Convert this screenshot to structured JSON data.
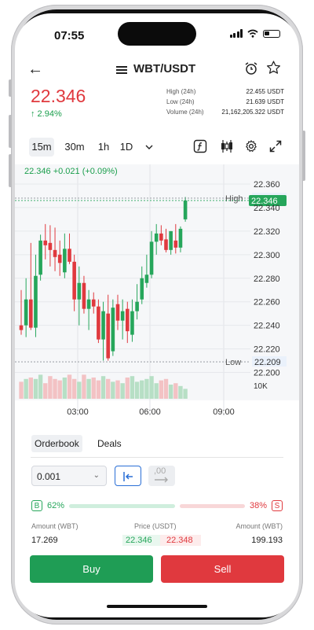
{
  "status": {
    "time": "07:55"
  },
  "header": {
    "pair": "WBT/USDT"
  },
  "ticker": {
    "price": "22.346",
    "change": "↑ 2.94%",
    "stats": [
      {
        "label": "High (24h)",
        "value": "22.455 USDT"
      },
      {
        "label": "Low (24h)",
        "value": "21.639 USDT"
      },
      {
        "label": "Volume (24h)",
        "value": "21,162,205.322 USDT"
      }
    ]
  },
  "toolbar": {
    "timeframes": [
      "15m",
      "30m",
      "1h",
      "1D"
    ],
    "active_timeframe": "15m",
    "icons": [
      "chevron-down-icon",
      "formula-icon",
      "candles-icon",
      "gear-icon",
      "expand-icon"
    ]
  },
  "chart_data": {
    "type": "candlestick",
    "title": "",
    "header_label": "22.346 +0.021 (+0.09%)",
    "xlabel": "",
    "ylabel": "",
    "x_ticks": [
      "03:00",
      "06:00",
      "09:00"
    ],
    "y_ticks": [
      "22.360",
      "22.340",
      "22.320",
      "22.300",
      "22.280",
      "22.260",
      "22.240",
      "22.220",
      "22.200"
    ],
    "ylim": [
      22.195,
      22.362
    ],
    "markers": [
      {
        "label": "High",
        "value": "22.348",
        "price": 22.348
      },
      {
        "label": "",
        "value": "22.346",
        "price": 22.346
      },
      {
        "label": "Low",
        "value": "22.209",
        "price": 22.209
      }
    ],
    "volume_label": "10K",
    "candles": [
      {
        "o": 22.24,
        "h": 22.27,
        "l": 22.232,
        "c": 22.236
      },
      {
        "o": 22.24,
        "h": 22.28,
        "l": 22.23,
        "c": 22.262
      },
      {
        "o": 22.262,
        "h": 22.31,
        "l": 22.236,
        "c": 22.238
      },
      {
        "o": 22.238,
        "h": 22.3,
        "l": 22.23,
        "c": 22.282
      },
      {
        "o": 22.283,
        "h": 22.317,
        "l": 22.278,
        "c": 22.312
      },
      {
        "o": 22.312,
        "h": 22.326,
        "l": 22.296,
        "c": 22.308
      },
      {
        "o": 22.31,
        "h": 22.325,
        "l": 22.29,
        "c": 22.304
      },
      {
        "o": 22.304,
        "h": 22.323,
        "l": 22.286,
        "c": 22.298
      },
      {
        "o": 22.3,
        "h": 22.312,
        "l": 22.282,
        "c": 22.293
      },
      {
        "o": 22.285,
        "h": 22.318,
        "l": 22.28,
        "c": 22.305
      },
      {
        "o": 22.305,
        "h": 22.318,
        "l": 22.292,
        "c": 22.294
      },
      {
        "o": 22.294,
        "h": 22.3,
        "l": 22.252,
        "c": 22.262
      },
      {
        "o": 22.262,
        "h": 22.29,
        "l": 22.24,
        "c": 22.276
      },
      {
        "o": 22.276,
        "h": 22.282,
        "l": 22.25,
        "c": 22.254
      },
      {
        "o": 22.254,
        "h": 22.27,
        "l": 22.236,
        "c": 22.262
      },
      {
        "o": 22.262,
        "h": 22.268,
        "l": 22.25,
        "c": 22.256
      },
      {
        "o": 22.256,
        "h": 22.262,
        "l": 22.225,
        "c": 22.228
      },
      {
        "o": 22.228,
        "h": 22.26,
        "l": 22.21,
        "c": 22.252
      },
      {
        "o": 22.25,
        "h": 22.266,
        "l": 22.21,
        "c": 22.212
      },
      {
        "o": 22.218,
        "h": 22.262,
        "l": 22.214,
        "c": 22.255
      },
      {
        "o": 22.258,
        "h": 22.266,
        "l": 22.236,
        "c": 22.244
      },
      {
        "o": 22.244,
        "h": 22.262,
        "l": 22.228,
        "c": 22.252
      },
      {
        "o": 22.254,
        "h": 22.26,
        "l": 22.225,
        "c": 22.235
      },
      {
        "o": 22.232,
        "h": 22.262,
        "l": 22.226,
        "c": 22.252
      },
      {
        "o": 22.252,
        "h": 22.275,
        "l": 22.245,
        "c": 22.26
      },
      {
        "o": 22.262,
        "h": 22.29,
        "l": 22.258,
        "c": 22.28
      },
      {
        "o": 22.276,
        "h": 22.3,
        "l": 22.272,
        "c": 22.283
      },
      {
        "o": 22.283,
        "h": 22.32,
        "l": 22.28,
        "c": 22.311
      },
      {
        "o": 22.311,
        "h": 22.326,
        "l": 22.3,
        "c": 22.318
      },
      {
        "o": 22.318,
        "h": 22.325,
        "l": 22.308,
        "c": 22.312
      },
      {
        "o": 22.313,
        "h": 22.322,
        "l": 22.302,
        "c": 22.304
      },
      {
        "o": 22.304,
        "h": 22.32,
        "l": 22.3,
        "c": 22.32
      },
      {
        "o": 22.312,
        "h": 22.326,
        "l": 22.301,
        "c": 22.306
      },
      {
        "o": 22.306,
        "h": 22.324,
        "l": 22.302,
        "c": 22.322
      },
      {
        "o": 22.33,
        "h": 22.349,
        "l": 22.328,
        "c": 22.346
      }
    ],
    "volumes": [
      0.6,
      0.7,
      0.75,
      0.7,
      0.85,
      0.55,
      0.8,
      0.7,
      0.65,
      0.75,
      0.85,
      0.7,
      0.6,
      0.85,
      0.7,
      0.75,
      0.65,
      0.8,
      0.7,
      0.6,
      0.65,
      0.55,
      0.75,
      0.8,
      0.6,
      0.65,
      0.7,
      0.8,
      0.55,
      0.65,
      0.7,
      0.5,
      0.55,
      0.45,
      0.35
    ]
  },
  "orderbook": {
    "tabs": [
      "Orderbook",
      "Deals"
    ],
    "active_tab": "Orderbook",
    "precision": "0.001",
    "depth_icon_label": ",00",
    "buy_badge": "B",
    "sell_badge": "S",
    "buy_pct": "62%",
    "sell_pct": "38%",
    "buy_ratio": 0.62,
    "columns": [
      "Amount (WBT)",
      "Price (USDT)",
      "Amount (WBT)"
    ],
    "row": {
      "bid_amount": "17.269",
      "bid_price": "22.346",
      "ask_price": "22.348",
      "ask_amount": "199.193"
    }
  },
  "actions": {
    "buy": "Buy",
    "sell": "Sell"
  },
  "colors": {
    "up": "#26a65b",
    "down": "#e0393e",
    "accent": "#2a6fd6"
  }
}
